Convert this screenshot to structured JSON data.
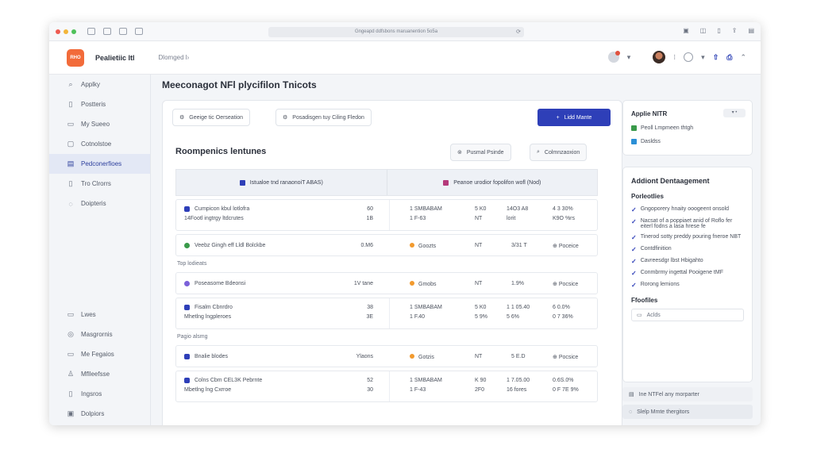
{
  "browser": {
    "url": "Gngeapd ddfsbons maruanention 5o5a"
  },
  "header": {
    "logo_text": "RHO",
    "app_name": "Pealietiic ltl",
    "breadcrumb": "Dlomged l›"
  },
  "sidebar": {
    "items": [
      {
        "icon": "search-icon",
        "glyph": "⌕",
        "label": "Applky"
      },
      {
        "icon": "folder-icon",
        "glyph": "▯",
        "label": "Postteris"
      },
      {
        "icon": "calendar-icon",
        "glyph": "▭",
        "label": "My Sueeo"
      },
      {
        "icon": "document-icon",
        "glyph": "▢",
        "label": "Cotnolstoe"
      },
      {
        "icon": "list-icon",
        "glyph": "▤",
        "label": "Pedconerfioes"
      },
      {
        "icon": "note-icon",
        "glyph": "▯",
        "label": "Tro Clrorrs"
      },
      {
        "icon": "pin-icon",
        "glyph": "◌",
        "label": "Doipteris"
      }
    ],
    "bottom_items": [
      {
        "icon": "library-icon",
        "glyph": "▭",
        "label": "Lwes"
      },
      {
        "icon": "settings-icon",
        "glyph": "◎",
        "label": "Masgrornis"
      },
      {
        "icon": "chat-icon",
        "glyph": "▭",
        "label": "Me Fegaios"
      },
      {
        "icon": "user-icon",
        "glyph": "♙",
        "label": "Mflleefsse"
      },
      {
        "icon": "archive-icon",
        "glyph": "▯",
        "label": "Ingsros"
      },
      {
        "icon": "box-icon",
        "glyph": "▣",
        "label": "Dolpiors"
      }
    ]
  },
  "main": {
    "title": "Meeconagot NFl plycifilon Tnicots",
    "chip1": "Geeige tic Oerseation",
    "chip2": "Posadisgen tuy Ciling Fledon",
    "primary_button": "Lidd Mante",
    "section_title": "Roompenics lentunes",
    "sec_btn1": "Pusmal Psinde",
    "sec_btn2": "Colmnzaoxion",
    "table_head_left": "Istualoe tnd ranaonoiT ABAS)",
    "table_head_right": "Peanoe urodior fopolifon wofl (Nod)",
    "rows": [
      {
        "type": "tall",
        "icon_color": "#2e3fb8",
        "name1": "Cumpicon kbul lotlofra",
        "name2": "14Footl ingtrgy ltdcrutes",
        "v1a": "60",
        "v1b": "1B",
        "c1a": "1 SMBABAM",
        "c1b": "1 F-63",
        "c2a": "5 K0",
        "c2b": "NT",
        "c3a": "14O3 A8",
        "c3b": "lorit",
        "c4a": "4 3 30%",
        "c4b": "K9O %rs"
      },
      {
        "type": "short",
        "icon_color": "#3a9a4a",
        "name1": "Veebz Gingh eff Lldl Bolckbe",
        "v1a": "0.M6",
        "status": "Goozts",
        "c2a": "NT",
        "c3a": "3/31 T",
        "c4a": "Poceice"
      }
    ],
    "group1": "Top lodieats",
    "rows_group1": [
      {
        "type": "short",
        "icon_color": "#7b61d9",
        "name1": "Poseasome Bdeonsi",
        "v1a": "1V tane",
        "status": "Gmobs",
        "c2a": "NT",
        "c3a": "1.9%",
        "c4a": "Pocsice"
      },
      {
        "type": "tall",
        "icon_color": "#2e3fb8",
        "name1": "Fisalm Cbnrdro",
        "name2": "Mhetlng lngpleroes",
        "v1a": "38",
        "v1b": "3E",
        "c1a": "1 SMBABAM",
        "c1b": "1 F.40",
        "c2a": "5 K0",
        "c2b": "5 9%",
        "c3a": "1 1 05.40",
        "c3b": "5 6%",
        "c4a": "6 0.0%",
        "c4b": "0 7 36%"
      }
    ],
    "group2": "Pagio alsmg",
    "rows_group2": [
      {
        "type": "short",
        "icon_color": "#2e3fb8",
        "name1": "Bnalie blodes",
        "v1a": "Ylaons",
        "status": "Gotzis",
        "c2a": "NT",
        "c3a": "5 E.D",
        "c4a": "Pocsice"
      },
      {
        "type": "tall",
        "icon_color": "#2e3fb8",
        "name1": "Colns Cbm CEL3K Pebrnte",
        "name2": "Mbetlng lng Cxrroe",
        "v1a": "52",
        "v1b": "30",
        "c1a": "1 SMBABAM",
        "c1b": "1 F-43",
        "c2a": "K 90",
        "c2b": "2F0",
        "c3a": "1 7.05.00",
        "c3b": "16 fores",
        "c4a": "0.6S.0%",
        "c4b": "0 F 7E 9%"
      }
    ]
  },
  "right": {
    "card1_title": "Applie NITR",
    "card1_dd": "▾ •",
    "card1_items": [
      {
        "color": "#3a9a4a",
        "label": "Peoll Lmpmeen thtgh"
      },
      {
        "color": "#2b8fd6",
        "label": "Dasldss"
      }
    ],
    "card2_title": "Addiont Dentaagement",
    "card2_sub": "Porleotlies",
    "checks": [
      "Gngoporery hnaity ooogeent onsold",
      "Nacsat of a poppiaet anid of Roflo fer eiterl fodns a lasa hrese fe",
      "Tinerod sotty preddy pouring fneroe NBT",
      "Contdfinition",
      "Cavreesdgr lbst Hbigahto",
      "Conmbrmy ingettal Pooigene tMF",
      "Rorong lemions"
    ],
    "profiles_title": "Ffoofiles",
    "profiles_input": "Aclds",
    "foot1": "Ine NTFel any morparter",
    "foot2": "Slelp Mmte thergitors"
  }
}
